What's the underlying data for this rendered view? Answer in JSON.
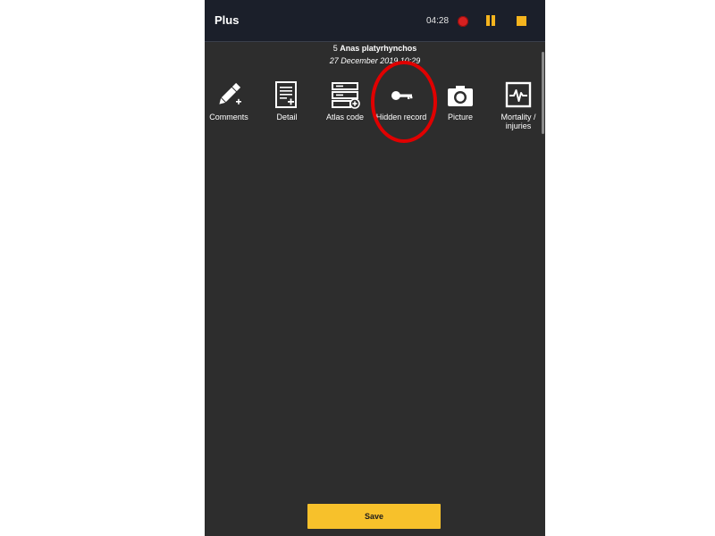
{
  "header": {
    "title": "Plus",
    "timer": "04:28",
    "record_icon": "record-icon",
    "pause_icon": "pause-icon",
    "stop_icon": "stop-icon",
    "accent_color": "#f5b41e"
  },
  "record": {
    "count": "5",
    "species": "Anas platyrhynchos",
    "datetime": "27 December 2019 10:29"
  },
  "toolbar": {
    "items": [
      {
        "label": "Comments",
        "icon": "pencil-plus-icon"
      },
      {
        "label": "Detail",
        "icon": "document-plus-icon"
      },
      {
        "label": "Atlas code",
        "icon": "server-plus-icon"
      },
      {
        "label": "Hidden record",
        "icon": "key-icon"
      },
      {
        "label": "Picture",
        "icon": "camera-icon"
      },
      {
        "label": "Mortality / injuries",
        "icon": "heartbeat-icon"
      }
    ]
  },
  "footer": {
    "save_label": "Save",
    "save_color": "#f7c12b"
  }
}
